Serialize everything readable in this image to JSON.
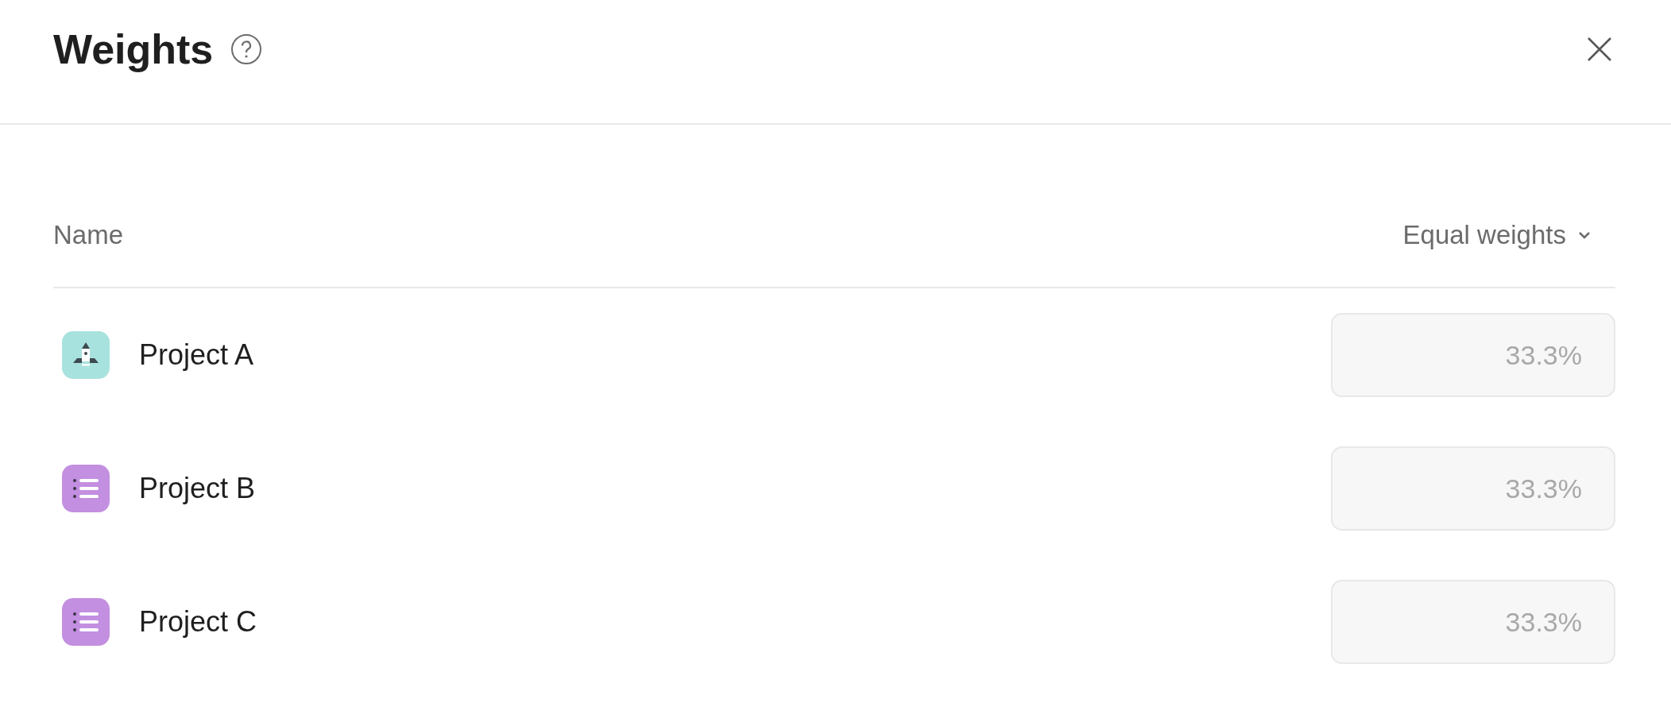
{
  "dialog": {
    "title": "Weights"
  },
  "table": {
    "columns": [
      {
        "label": "Name"
      },
      {
        "label": "Equal weights",
        "kind": "dropdown"
      }
    ],
    "rows": [
      {
        "name": "Project A",
        "kind": "rocket",
        "color": "#a8e2de",
        "value": "33.3%",
        "disabled": true
      },
      {
        "name": "Project B",
        "kind": "list",
        "color": "#c38fe0",
        "value": "33.3%",
        "disabled": true
      },
      {
        "name": "Project C",
        "kind": "list",
        "color": "#c38fe0",
        "value": "33.3%",
        "disabled": true
      }
    ]
  }
}
